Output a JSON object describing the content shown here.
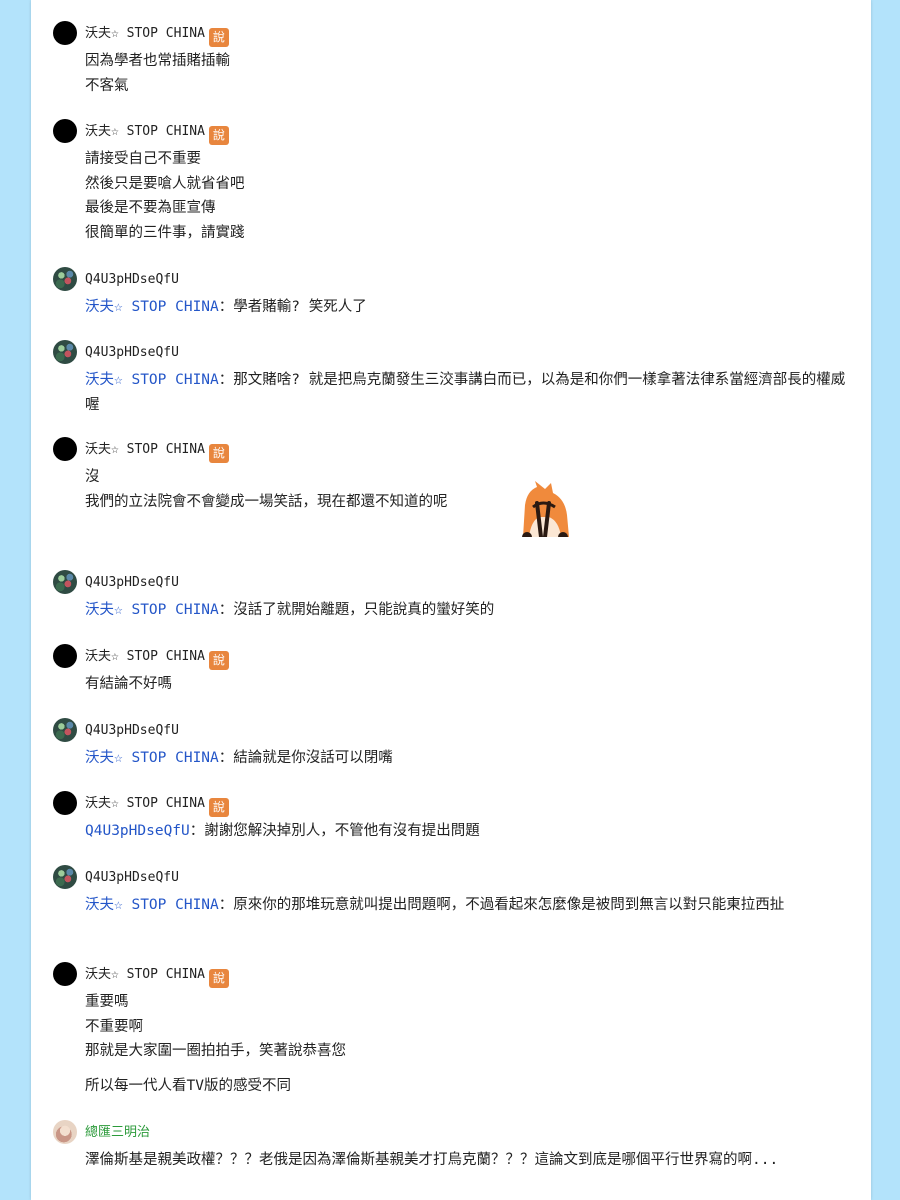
{
  "comments": [
    {
      "user": "沃夫☆ STOP CHINA",
      "badge": "說",
      "lines": [
        "因為學者也常插賭插輸",
        "不客氣"
      ]
    },
    {
      "user": "沃夫☆ STOP CHINA",
      "badge": "說",
      "lines": [
        "請接受自己不重要",
        "然後只是要嗆人就省省吧",
        "最後是不要為匪宣傳",
        "很簡單的三件事，請實踐"
      ]
    },
    {
      "user": "Q4U3pHDseQfU",
      "mention": "沃夫☆ STOP CHINA",
      "text": "：學者賭輸? 笑死人了"
    },
    {
      "user": "Q4U3pHDseQfU",
      "mention": "沃夫☆ STOP CHINA",
      "text": "：那文賭啥? 就是把烏克蘭發生三洨事講白而已，以為是和你們一樣拿著法律系當經濟部長的權威喔"
    },
    {
      "user": "沃夫☆ STOP CHINA",
      "badge": "說",
      "lines": [
        "沒",
        "我們的立法院會不會變成一場笑話，現在都還不知道的呢"
      ]
    },
    {
      "user": "Q4U3pHDseQfU",
      "mention": "沃夫☆ STOP CHINA",
      "text": "：沒話了就開始離題，只能說真的蠻好笑的"
    },
    {
      "user": "沃夫☆ STOP CHINA",
      "badge": "說",
      "lines": [
        "有結論不好嗎"
      ]
    },
    {
      "user": "Q4U3pHDseQfU",
      "mention": "沃夫☆ STOP CHINA",
      "text": "：結論就是你沒話可以閉嘴"
    },
    {
      "user": "沃夫☆ STOP CHINA",
      "badge": "說",
      "mention": "Q4U3pHDseQfU",
      "text": "：謝謝您解決掉別人，不管他有沒有提出問題"
    },
    {
      "user": "Q4U3pHDseQfU",
      "mention": "沃夫☆ STOP CHINA",
      "text": "：原來你的那堆玩意就叫提出問題啊，不過看起來怎麼像是被問到無言以對只能東拉西扯"
    },
    {
      "user": "沃夫☆ STOP CHINA",
      "badge": "說",
      "lines": [
        "重要嗎",
        "不重要啊",
        "那就是大家圍一圈拍拍手，笑著說恭喜您"
      ],
      "extra": "所以每一代人看TV版的感受不同"
    },
    {
      "user": "總匯三明治",
      "text": "澤倫斯基是親美政權？？？老俄是因為澤倫斯基親美才打烏克蘭？？？這論文到底是哪個平行世界寫的啊..."
    }
  ]
}
